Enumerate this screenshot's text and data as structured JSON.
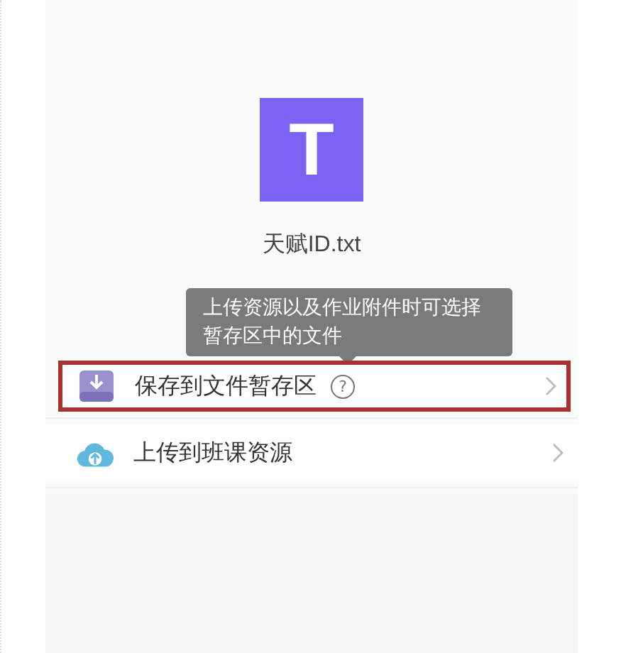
{
  "file": {
    "icon_letter": "T",
    "name": "天赋ID.txt"
  },
  "tooltip": {
    "text": "上传资源以及作业附件时可选择暂存区中的文件"
  },
  "actions": [
    {
      "kind": "save",
      "label": "保存到文件暂存区",
      "help": "?",
      "highlighted": true
    },
    {
      "kind": "upload",
      "label": "上传到班课资源",
      "highlighted": false
    }
  ]
}
